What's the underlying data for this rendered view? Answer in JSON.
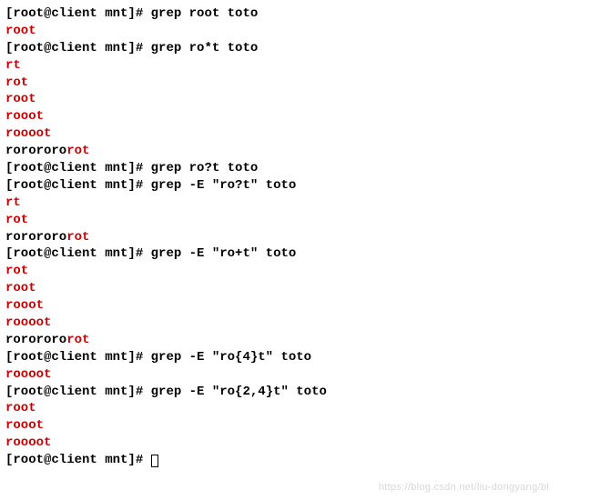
{
  "prompt": "[root@client mnt]# ",
  "lines": [
    {
      "type": "cmd",
      "command": "grep root toto"
    },
    {
      "type": "out",
      "segments": [
        {
          "text": "root",
          "match": true
        }
      ]
    },
    {
      "type": "cmd",
      "command": "grep ro*t toto"
    },
    {
      "type": "out",
      "segments": [
        {
          "text": "rt",
          "match": true
        }
      ]
    },
    {
      "type": "out",
      "segments": [
        {
          "text": "rot",
          "match": true
        }
      ]
    },
    {
      "type": "out",
      "segments": [
        {
          "text": "root",
          "match": true
        }
      ]
    },
    {
      "type": "out",
      "segments": [
        {
          "text": "rooot",
          "match": true
        }
      ]
    },
    {
      "type": "out",
      "segments": [
        {
          "text": "roooot",
          "match": true
        }
      ]
    },
    {
      "type": "out",
      "segments": [
        {
          "text": "rorororo",
          "match": false
        },
        {
          "text": "rot",
          "match": true
        }
      ]
    },
    {
      "type": "cmd",
      "command": "grep ro?t toto"
    },
    {
      "type": "cmd",
      "command": "grep -E \"ro?t\" toto"
    },
    {
      "type": "out",
      "segments": [
        {
          "text": "rt",
          "match": true
        }
      ]
    },
    {
      "type": "out",
      "segments": [
        {
          "text": "rot",
          "match": true
        }
      ]
    },
    {
      "type": "out",
      "segments": [
        {
          "text": "rorororo",
          "match": false
        },
        {
          "text": "rot",
          "match": true
        }
      ]
    },
    {
      "type": "cmd",
      "command": "grep -E \"ro+t\" toto"
    },
    {
      "type": "out",
      "segments": [
        {
          "text": "rot",
          "match": true
        }
      ]
    },
    {
      "type": "out",
      "segments": [
        {
          "text": "root",
          "match": true
        }
      ]
    },
    {
      "type": "out",
      "segments": [
        {
          "text": "rooot",
          "match": true
        }
      ]
    },
    {
      "type": "out",
      "segments": [
        {
          "text": "roooot",
          "match": true
        }
      ]
    },
    {
      "type": "out",
      "segments": [
        {
          "text": "rorororo",
          "match": false
        },
        {
          "text": "rot",
          "match": true
        }
      ]
    },
    {
      "type": "cmd",
      "command": "grep -E \"ro{4}t\" toto"
    },
    {
      "type": "out",
      "segments": [
        {
          "text": "roooot",
          "match": true
        }
      ]
    },
    {
      "type": "cmd",
      "command": "grep -E \"ro{2,4}t\" toto"
    },
    {
      "type": "out",
      "segments": [
        {
          "text": "root",
          "match": true
        }
      ]
    },
    {
      "type": "out",
      "segments": [
        {
          "text": "rooot",
          "match": true
        }
      ]
    },
    {
      "type": "out",
      "segments": [
        {
          "text": "roooot",
          "match": true
        }
      ]
    },
    {
      "type": "cmd",
      "command": "",
      "cursor": true
    }
  ],
  "watermark": "https://blog.csdn.net/liu-dongyang/bl"
}
